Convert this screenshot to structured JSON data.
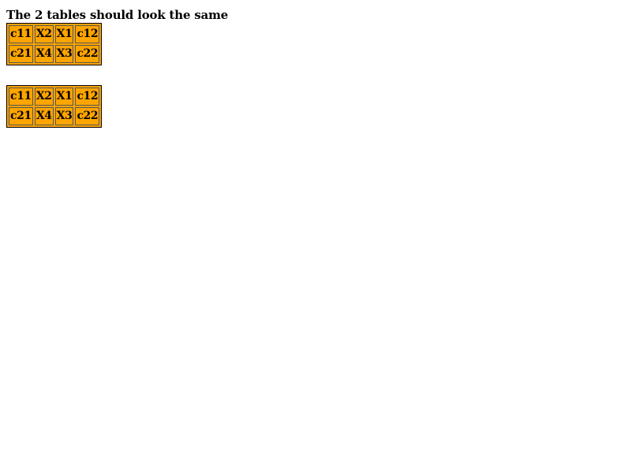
{
  "heading": "The 2 tables should look the same",
  "tables": [
    {
      "rows": [
        [
          "c11",
          "X2",
          "X1",
          "c12"
        ],
        [
          "c21",
          "X4",
          "X3",
          "c22"
        ]
      ]
    },
    {
      "rows": [
        [
          "c11",
          "X2",
          "X1",
          "c12"
        ],
        [
          "c21",
          "X4",
          "X3",
          "c22"
        ]
      ]
    }
  ],
  "colors": {
    "cell_background": "#ffa500",
    "table_border": "#000000",
    "cell_border": "#555555",
    "text": "#000000",
    "page_background": "#ffffff"
  }
}
